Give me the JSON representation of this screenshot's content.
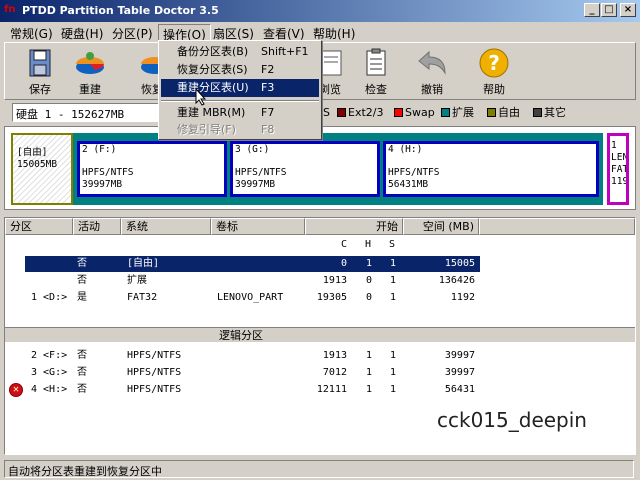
{
  "window": {
    "title": "PTDD Partition Table Doctor 3.5",
    "app_icon": "fn",
    "min": "_",
    "max": "□",
    "close": "×"
  },
  "menu": [
    {
      "label": "常规(G)"
    },
    {
      "label": "硬盘(H)"
    },
    {
      "label": "分区(P)"
    },
    {
      "label": "操作(O)"
    },
    {
      "label": "扇区(S)"
    },
    {
      "label": "查看(V)"
    },
    {
      "label": "帮助(H)"
    }
  ],
  "dropdown": {
    "items": [
      {
        "label": "备份分区表(B)",
        "key": "Shift+F1"
      },
      {
        "label": "恢复分区表(S)",
        "key": "F2"
      },
      {
        "label": "重建分区表(U)",
        "key": "F3"
      },
      {
        "label": "重建 MBR(M)",
        "key": "F7"
      },
      {
        "label": "修复引导(F)",
        "key": "F8"
      }
    ]
  },
  "toolbar": {
    "save": "保存",
    "rebuild": "重建",
    "restore": "恢复",
    "browse": "浏览",
    "check": "检查",
    "undo": "撤销",
    "help": "帮助"
  },
  "disk_select": "硬盘 1 - 152627MB",
  "legend": {
    "s_label": "S",
    "ext23": "Ext2/3",
    "swap": "Swap",
    "extended": "扩展",
    "free": "自由",
    "other": "其它",
    "colors": {
      "ext23": "#800000",
      "swap": "#ff0000",
      "extended": "#008080",
      "free": "#808000",
      "other": "#404040"
    }
  },
  "partition_map": {
    "free": {
      "line1": "[自由]",
      "line2": "15005MB"
    },
    "p2": {
      "line1": "2 (F:)",
      "line2": "HPFS/NTFS",
      "line3": "39997MB"
    },
    "p3": {
      "line1": "3 (G:)",
      "line2": "HPFS/NTFS",
      "line3": "39997MB"
    },
    "p4": {
      "line1": "4 (H:)",
      "line2": "HPFS/NTFS",
      "line3": "56431MB"
    },
    "p1": {
      "line1": "1",
      "line2": "LEN",
      "line3": "FAT",
      "line4": "119"
    }
  },
  "grid": {
    "headers": {
      "partition": "分区",
      "active": "活动",
      "system": "系统",
      "label": "卷标",
      "start": "开始",
      "size": "空间 (MB)"
    },
    "subheaders": {
      "c": "C",
      "h": "H",
      "s": "S"
    },
    "rows": [
      {
        "part": "",
        "active": "否",
        "system": "[自由]",
        "label": "",
        "c": "0",
        "h": "1",
        "s": "1",
        "size": "15005"
      },
      {
        "part": "",
        "active": "否",
        "system": "扩展",
        "label": "",
        "c": "1913",
        "h": "0",
        "s": "1",
        "size": "136426"
      },
      {
        "part": "1 <D:>",
        "active": "是",
        "system": "FAT32",
        "label": "LENOVO_PART",
        "c": "19305",
        "h": "0",
        "s": "1",
        "size": "1192"
      }
    ],
    "logical_title": "逻辑分区",
    "logical_rows": [
      {
        "part": "2 <F:>",
        "active": "否",
        "system": "HPFS/NTFS",
        "label": "",
        "c": "1913",
        "h": "1",
        "s": "1",
        "size": "39997"
      },
      {
        "part": "3 <G:>",
        "active": "否",
        "system": "HPFS/NTFS",
        "label": "",
        "c": "7012",
        "h": "1",
        "s": "1",
        "size": "39997"
      },
      {
        "part": "4 <H:>",
        "active": "否",
        "system": "HPFS/NTFS",
        "label": "",
        "c": "12111",
        "h": "1",
        "s": "1",
        "size": "56431"
      }
    ]
  },
  "watermark": "cck015_deepin",
  "status": "自动将分区表重建到恢复分区中"
}
